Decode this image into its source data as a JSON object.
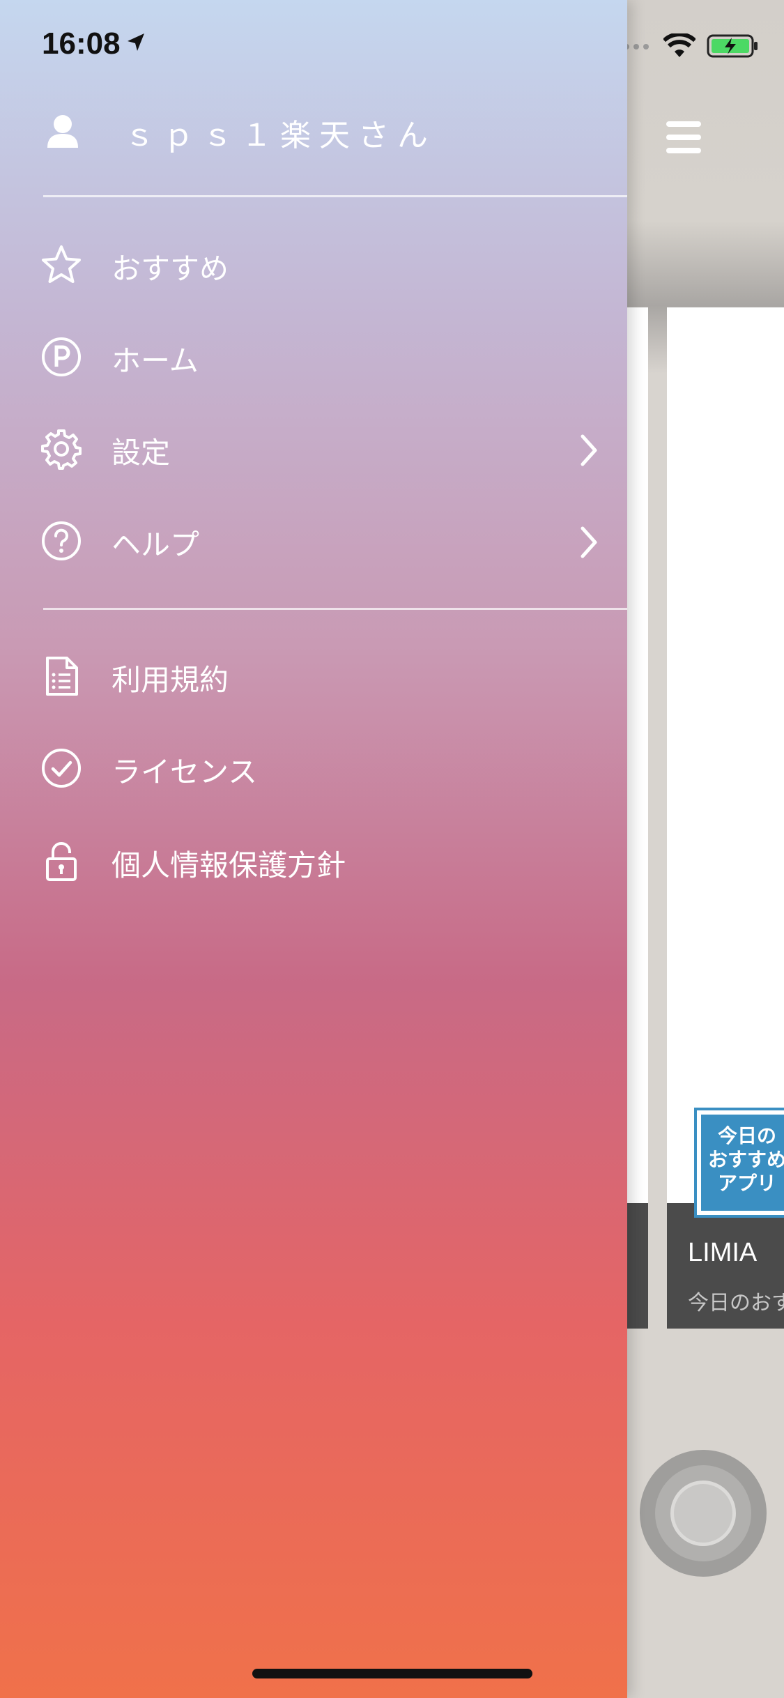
{
  "status_bar": {
    "time": "16:08"
  },
  "drawer": {
    "user_name": "ｓｐｓ１楽天さん",
    "menu_primary": [
      {
        "label": "おすすめ",
        "icon": "star-icon"
      },
      {
        "label": "ホーム",
        "icon": "points-icon"
      },
      {
        "label": "設定",
        "icon": "gear-icon",
        "has_chevron": true
      },
      {
        "label": "ヘルプ",
        "icon": "help-icon",
        "has_chevron": true
      }
    ],
    "menu_secondary": [
      {
        "label": "利用規約",
        "icon": "document-icon"
      },
      {
        "label": "ライセンス",
        "icon": "check-circle-icon"
      },
      {
        "label": "個人情報保護方針",
        "icon": "lock-icon"
      }
    ]
  },
  "background_app": {
    "card": {
      "badge_text": "今日の おすすめ アプリ",
      "title": "LIMIA",
      "subtitle": "今日のおす"
    }
  },
  "colors": {
    "drawer_top": "#c5d7ef",
    "drawer_bottom": "#f0714a",
    "badge": "#3a8fc2"
  }
}
